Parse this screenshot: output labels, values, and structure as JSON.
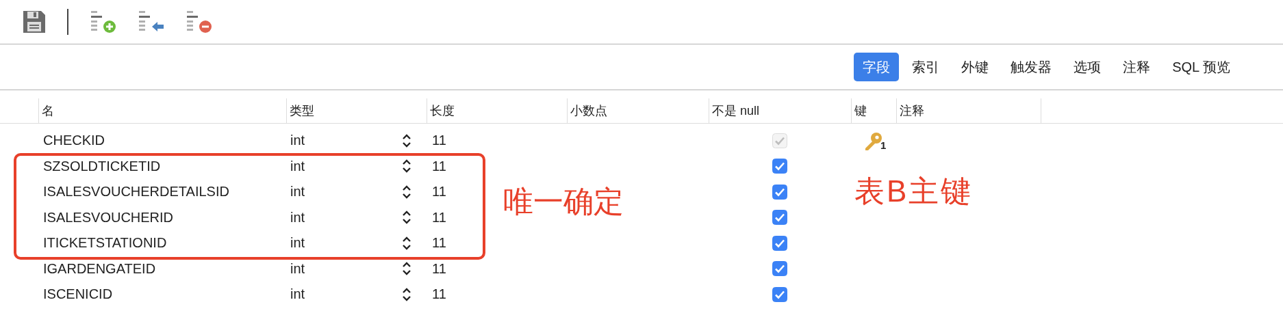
{
  "toolbar": [
    {
      "kind": "save"
    },
    {
      "kind": "separator"
    },
    {
      "kind": "add"
    },
    {
      "kind": "insert"
    },
    {
      "kind": "delete"
    }
  ],
  "tabs": [
    {
      "label": "字段",
      "selected": true
    },
    {
      "label": "索引",
      "selected": false
    },
    {
      "label": "外键",
      "selected": false
    },
    {
      "label": "触发器",
      "selected": false
    },
    {
      "label": "选项",
      "selected": false
    },
    {
      "label": "注释",
      "selected": false
    },
    {
      "label": "SQL 预览",
      "selected": false
    }
  ],
  "table": {
    "columns": [
      "名",
      "类型",
      "长度",
      "小数点",
      "不是 null",
      "键",
      "注释"
    ],
    "rows": [
      {
        "name": "CHECKID",
        "type": "int",
        "length": "11",
        "not_null": true,
        "disabled": true,
        "key": "1"
      },
      {
        "name": "SZSOLDTICKETID",
        "type": "int",
        "length": "11",
        "not_null": true,
        "disabled": false
      },
      {
        "name": "ISALESVOUCHERDETAILSID",
        "type": "int",
        "length": "11",
        "not_null": true,
        "disabled": false
      },
      {
        "name": "ISALESVOUCHERID",
        "type": "int",
        "length": "11",
        "not_null": true,
        "disabled": false
      },
      {
        "name": "ITICKETSTATIONID",
        "type": "int",
        "length": "11",
        "not_null": true,
        "disabled": false
      },
      {
        "name": "IGARDENGATEID",
        "type": "int",
        "length": "11",
        "not_null": true,
        "disabled": false
      },
      {
        "name": "ISCENICID",
        "type": "int",
        "length": "11",
        "not_null": true,
        "disabled": false
      }
    ]
  },
  "annotations": [
    {
      "kind": "box-label",
      "text": "唯一确定"
    },
    {
      "kind": "label",
      "text": "表B主键"
    }
  ]
}
